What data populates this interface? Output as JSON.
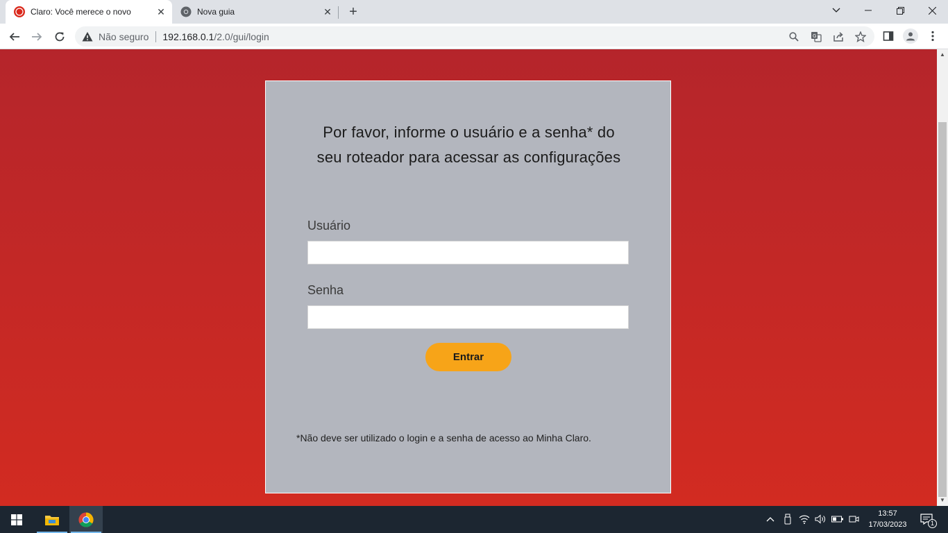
{
  "browser": {
    "tabs": [
      {
        "title": "Claro: Você merece o novo",
        "active": true,
        "favicon": "claro-logo-icon"
      },
      {
        "title": "Nova guia",
        "active": false,
        "favicon": "chrome-icon"
      }
    ],
    "address_bar": {
      "security_label": "Não seguro",
      "url_host": "192.168.0.1",
      "url_path": "/2.0/gui/login"
    }
  },
  "login": {
    "heading_line1": "Por favor, informe o usuário e a senha* do",
    "heading_line2": "seu roteador para acessar as configurações",
    "username_label": "Usuário",
    "username_value": "",
    "password_label": "Senha",
    "password_value": "",
    "submit_label": "Entrar",
    "footnote": "*Não deve ser utilizado o login e a senha de acesso ao Minha Claro."
  },
  "taskbar": {
    "time": "13:57",
    "date": "17/03/2023",
    "notification_count": "1"
  },
  "colors": {
    "page_top": "#b5252b",
    "page_bottom": "#d22b21",
    "card": "#b3b6be",
    "button": "#f7a418"
  }
}
